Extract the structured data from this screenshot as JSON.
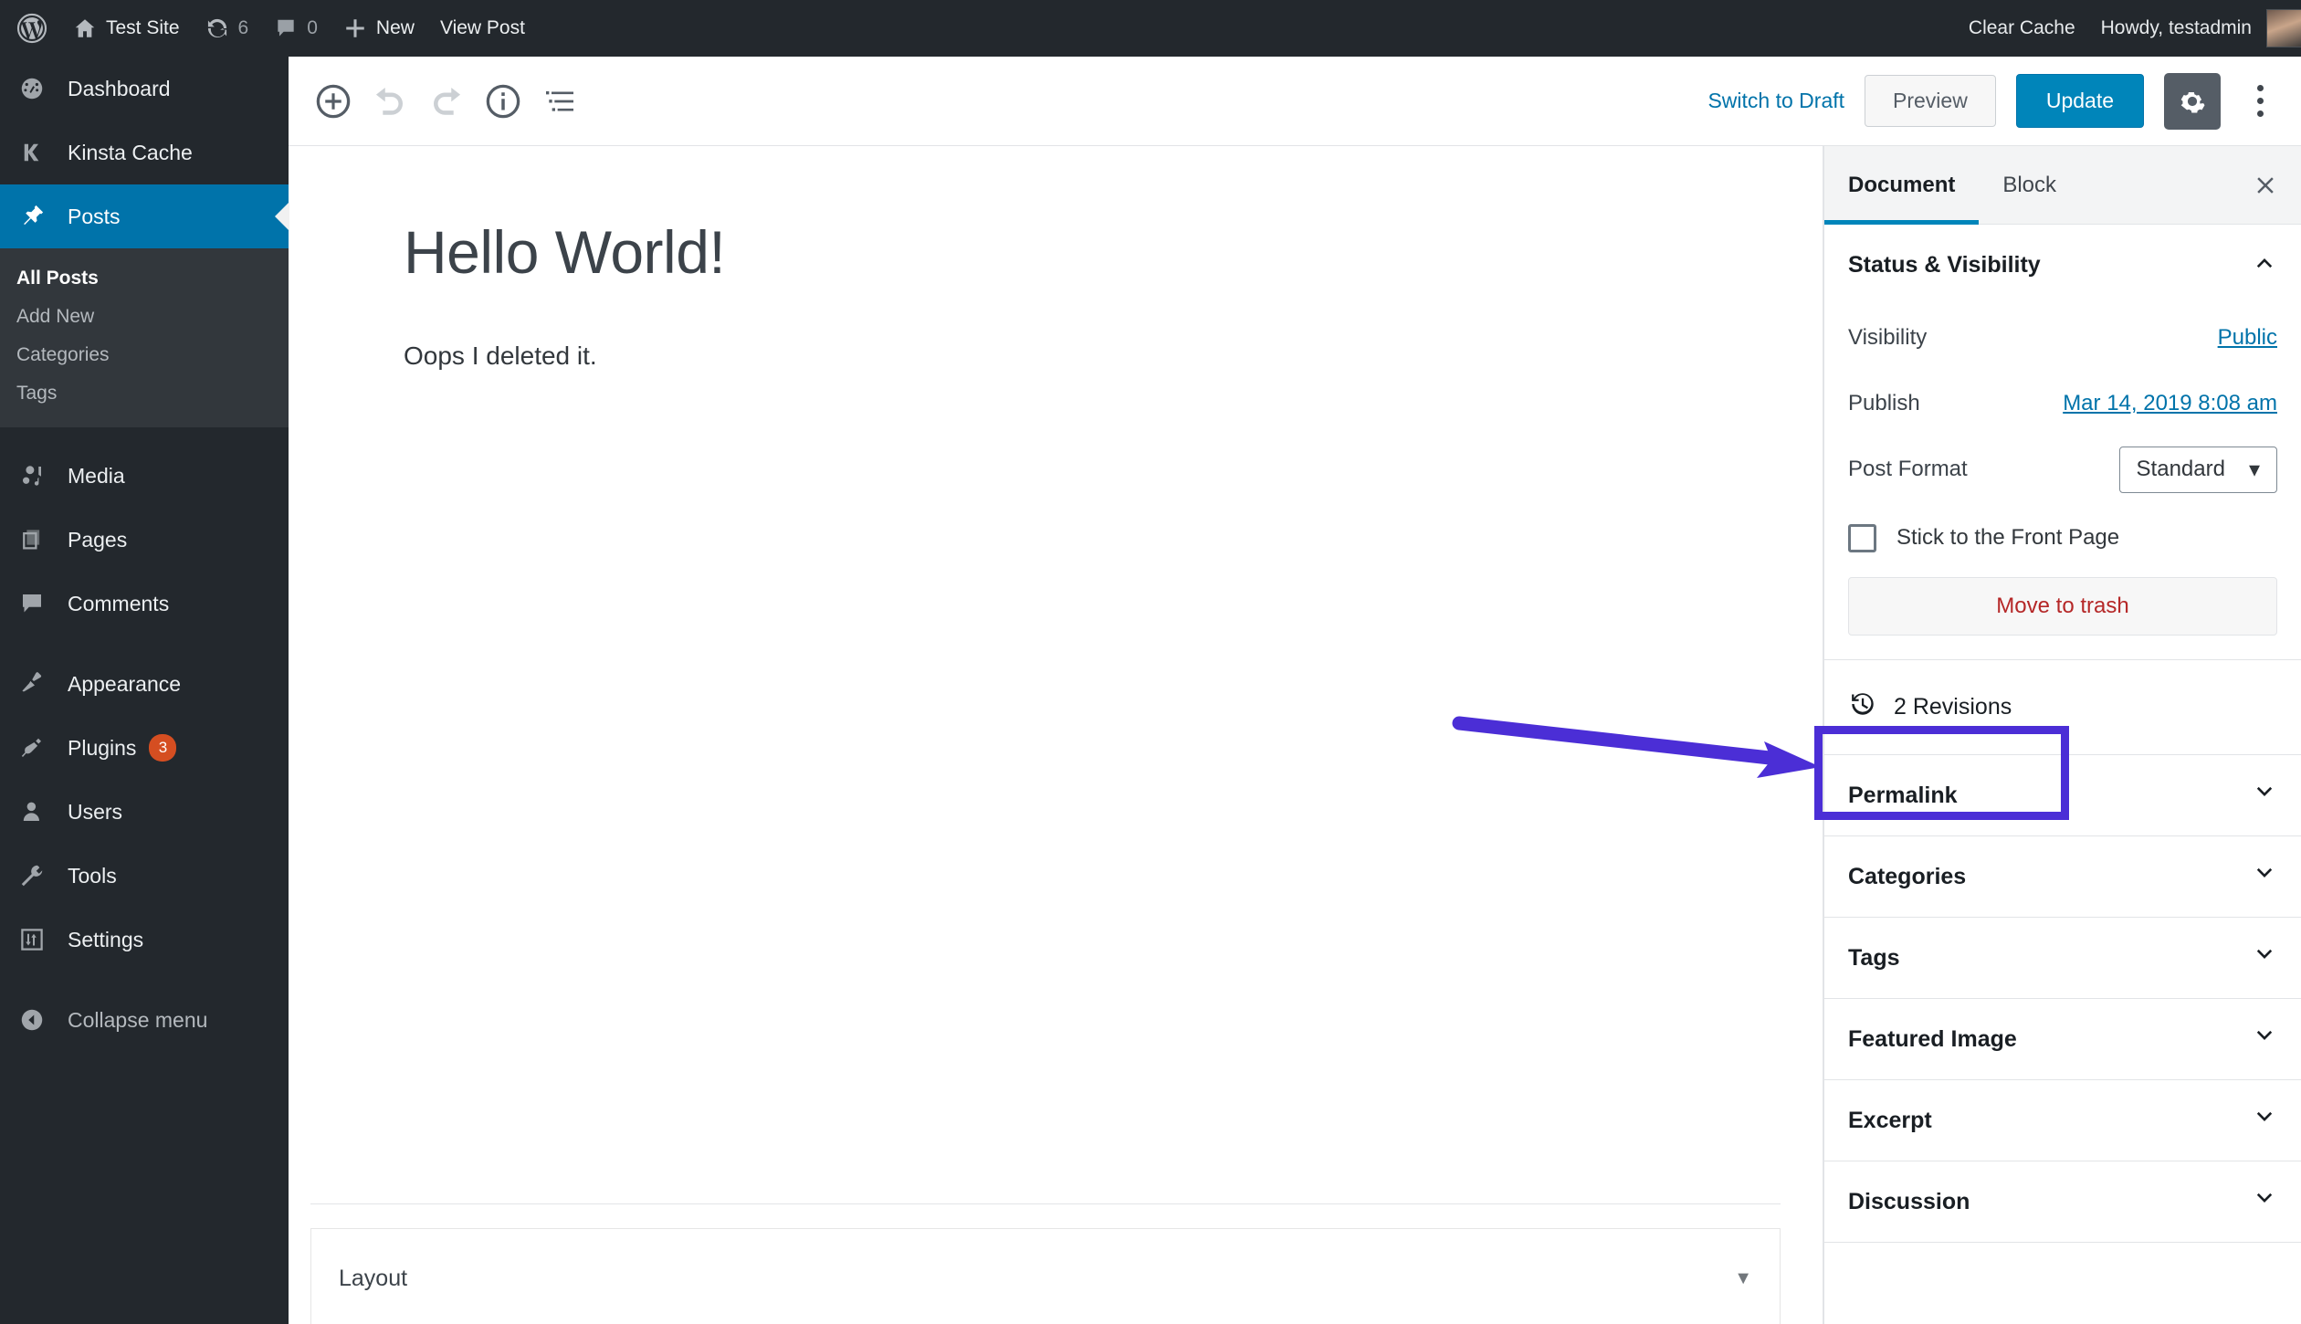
{
  "adminbar": {
    "logo_icon": "wordpress-logo-icon",
    "site_icon": "home-icon",
    "site_name": "Test Site",
    "updates_icon": "updates-icon",
    "updates_count": "6",
    "comments_icon": "comment-bubble-icon",
    "comments_count": "0",
    "new_icon": "plus-icon",
    "new_label": "New",
    "view_post_label": "View Post",
    "clear_cache_label": "Clear Cache",
    "howdy_label": "Howdy, testadmin",
    "avatar_icon": "user-avatar"
  },
  "sidebar": {
    "items": [
      {
        "label": "Dashboard",
        "icon": "dashboard-icon",
        "current": false
      },
      {
        "label": "Kinsta Cache",
        "icon": "kinsta-k-icon",
        "current": false
      },
      {
        "label": "Posts",
        "icon": "pin-icon",
        "current": true
      },
      {
        "label": "Media",
        "icon": "media-camera-icon",
        "current": false
      },
      {
        "label": "Pages",
        "icon": "pages-icon",
        "current": false
      },
      {
        "label": "Comments",
        "icon": "comment-bubble-icon",
        "current": false
      },
      {
        "label": "Appearance",
        "icon": "paintbrush-icon",
        "current": false
      },
      {
        "label": "Plugins",
        "icon": "plug-icon",
        "current": false,
        "badge": "3"
      },
      {
        "label": "Users",
        "icon": "user-icon",
        "current": false
      },
      {
        "label": "Tools",
        "icon": "wrench-icon",
        "current": false
      },
      {
        "label": "Settings",
        "icon": "sliders-icon",
        "current": false
      }
    ],
    "submenu": [
      {
        "label": "All Posts",
        "current": true
      },
      {
        "label": "Add New",
        "current": false
      },
      {
        "label": "Categories",
        "current": false
      },
      {
        "label": "Tags",
        "current": false
      }
    ],
    "collapse_label": "Collapse menu",
    "collapse_icon": "collapse-arrow-icon"
  },
  "header": {
    "add_block_icon": "add-block-plus-icon",
    "undo_icon": "undo-arrow-icon",
    "redo_icon": "redo-arrow-icon",
    "info_icon": "info-circle-icon",
    "block_nav_icon": "block-list-icon",
    "switch_to_draft": "Switch to Draft",
    "preview_label": "Preview",
    "update_label": "Update",
    "settings_gear_icon": "gear-icon",
    "more_menu_icon": "three-dots-vertical-icon"
  },
  "editor": {
    "title": "Hello World!",
    "body": "Oops I deleted it.",
    "metabox": {
      "title": "Layout",
      "toggle_icon": "triangle-down-icon"
    }
  },
  "settings_panel": {
    "tabs": [
      {
        "label": "Document",
        "active": true
      },
      {
        "label": "Block",
        "active": false
      }
    ],
    "close_icon": "close-x-icon",
    "status_visibility": {
      "title": "Status & Visibility",
      "chevron_icon": "chevron-up-icon",
      "visibility_label": "Visibility",
      "visibility_value": "Public",
      "publish_label": "Publish",
      "publish_value": "Mar 14, 2019 8:08 am",
      "post_format_label": "Post Format",
      "post_format_value": "Standard",
      "post_format_caret_icon": "caret-down-icon",
      "sticky_label": "Stick to the Front Page",
      "sticky_checkbox_icon": "checkbox-unchecked-icon",
      "trash_label": "Move to trash"
    },
    "revisions": {
      "label": "2 Revisions",
      "icon": "revisions-clock-icon"
    },
    "panels": [
      {
        "label": "Permalink",
        "chevron_icon": "chevron-down-icon"
      },
      {
        "label": "Categories",
        "chevron_icon": "chevron-down-icon"
      },
      {
        "label": "Tags",
        "chevron_icon": "chevron-down-icon"
      },
      {
        "label": "Featured Image",
        "chevron_icon": "chevron-down-icon"
      },
      {
        "label": "Excerpt",
        "chevron_icon": "chevron-down-icon"
      },
      {
        "label": "Discussion",
        "chevron_icon": "chevron-down-icon"
      }
    ]
  },
  "annotations": {
    "highlight_color": "#4b2ed6",
    "arrow_icon": "pointer-arrow-icon",
    "box_icon": "highlight-rectangle"
  }
}
